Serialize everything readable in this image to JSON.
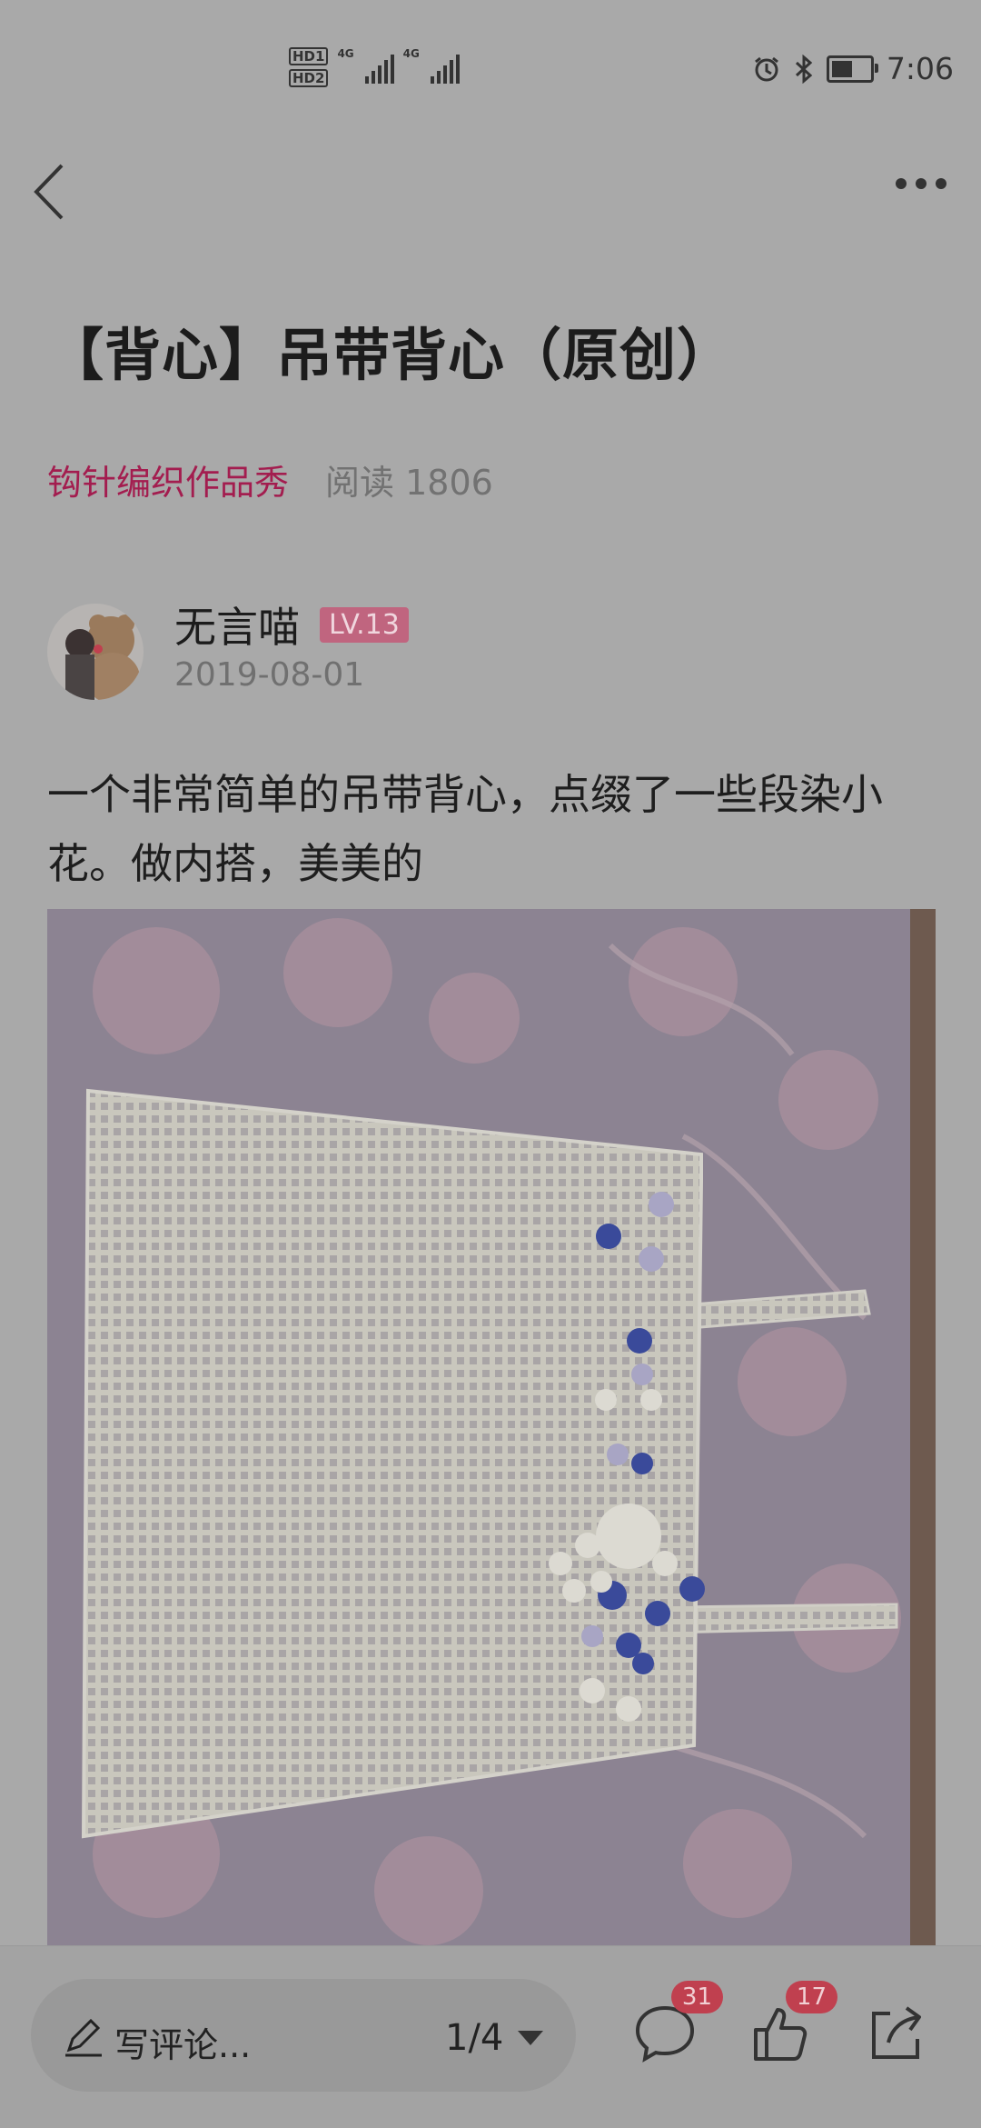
{
  "status_bar": {
    "hd1": "HD1",
    "hd2": "HD2",
    "net1": "4G",
    "net2": "4G",
    "time": "7:06",
    "battery_level": 0.55
  },
  "nav": {
    "back_icon": "chevron-left-icon",
    "more_icon": "more-horizontal-icon"
  },
  "post": {
    "title": "【背心】吊带背心（原创）",
    "group": "钩针编织作品秀",
    "reads": "阅读 1806",
    "author": "无言喵",
    "level": "LV.13",
    "date": "2019-08-01",
    "text": "一个非常简单的吊带背心，点缀了一些段染小花。做内搭，美美的"
  },
  "bottom": {
    "comment_placeholder": "写评论...",
    "pager": "1/4",
    "comment_count": "31",
    "like_count": "17"
  },
  "colors": {
    "accent": "#a31d4f",
    "badge": "#c0404f",
    "background": "#a9a9a9"
  }
}
